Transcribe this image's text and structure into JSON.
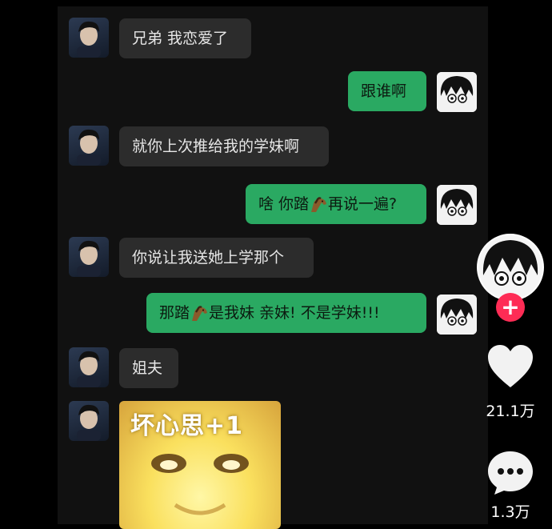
{
  "chat": {
    "messages": [
      {
        "side": "in",
        "text": "兄弟 我恋爱了"
      },
      {
        "side": "out",
        "text": "跟谁啊"
      },
      {
        "side": "in",
        "text": "就你上次推给我的学妹啊"
      },
      {
        "side": "out",
        "text_before": "啥 你踏",
        "icon": "horse-emoji-icon",
        "text_after": "再说一遍?"
      },
      {
        "side": "in",
        "text": "你说让我送她上学那个"
      },
      {
        "side": "out",
        "text_before": "那踏",
        "icon": "horse-emoji-icon",
        "text_after": "是我妹 亲妹! 不是学妹!!!"
      },
      {
        "side": "in",
        "text": "姐夫"
      },
      {
        "side": "in",
        "type": "sticker",
        "text": "坏心思+1"
      }
    ]
  },
  "sidebar": {
    "follow_label": "+",
    "likes": "21.1万",
    "comments": "1.3万",
    "like_color": "#f2f2f2",
    "follow_color": "#fe2c55"
  },
  "colors": {
    "incoming_bubble": "#2c2c2c",
    "outgoing_bubble": "#2aa962",
    "chat_background": "#111111"
  }
}
